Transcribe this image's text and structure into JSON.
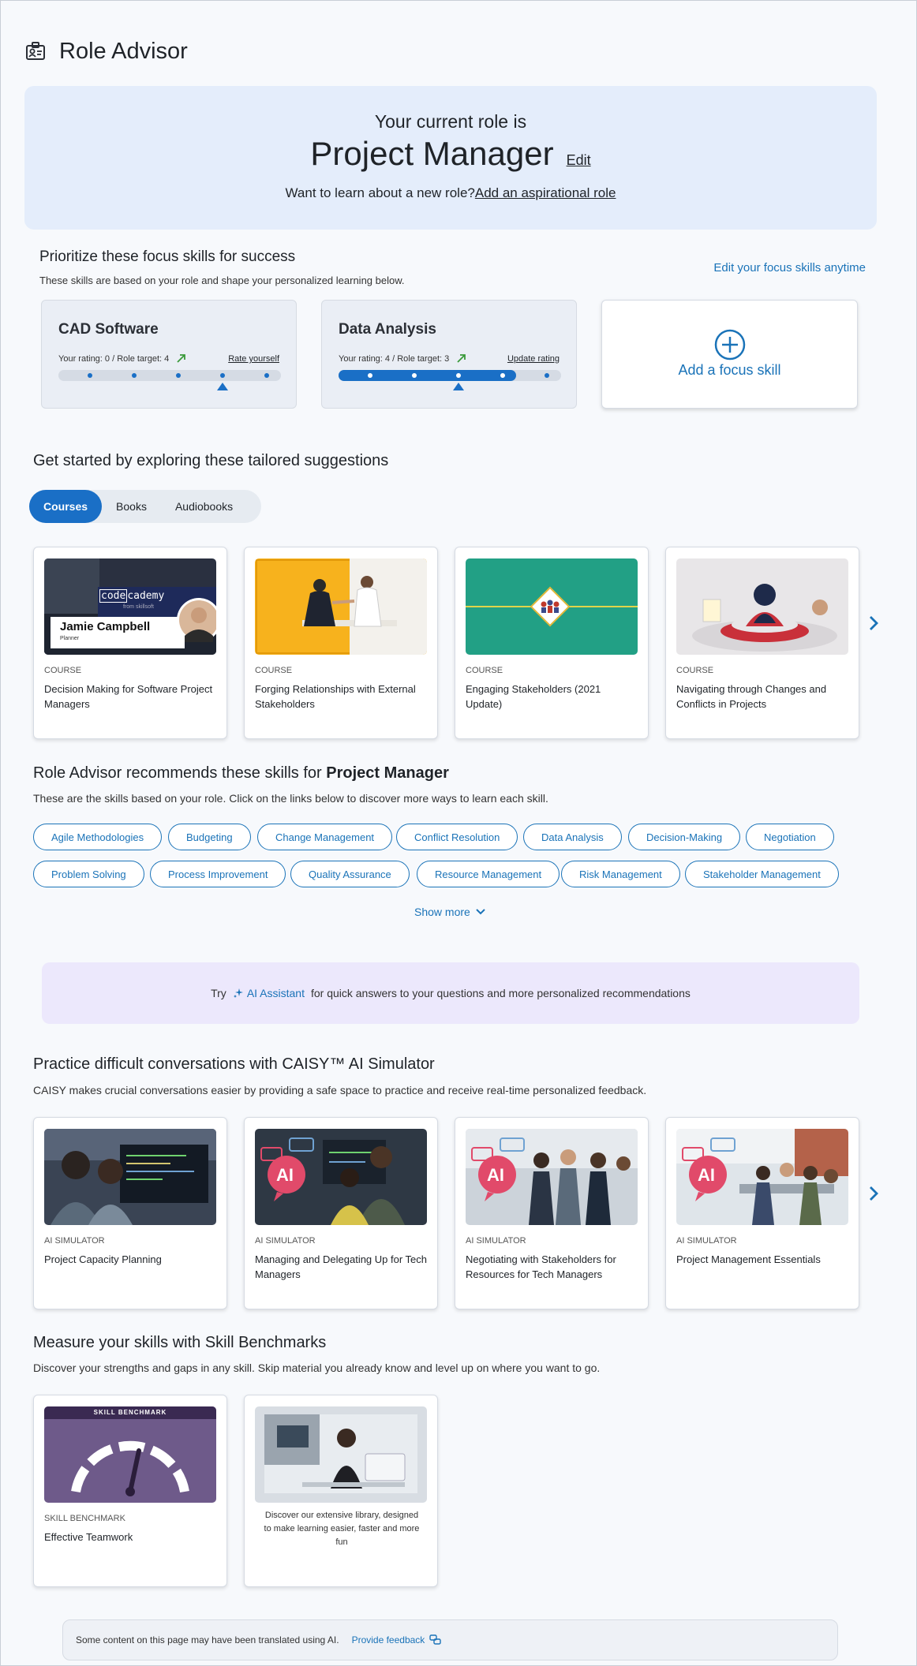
{
  "app": {
    "title": "Role Advisor",
    "icon": "id-badge-icon"
  },
  "hero": {
    "pre": "Your current role is",
    "role": "Project Manager",
    "edit_label": "Edit",
    "sub_text": "Want to learn about a new role?",
    "sub_link": "Add an aspirational role"
  },
  "focus": {
    "title": "Prioritize these focus skills for success",
    "description": "These skills are based on your role and shape your personalized learning below.",
    "edit_link": "Edit your focus skills anytime",
    "skills": [
      {
        "name": "CAD Software",
        "rating_text": "Your rating: 0 / Role target: 4",
        "rating": 0,
        "target": 4,
        "action": "Rate yourself"
      },
      {
        "name": "Data Analysis",
        "rating_text": "Your rating: 4 / Role target: 3",
        "rating": 4,
        "target": 3,
        "action": "Update rating"
      }
    ],
    "add_label": "Add a focus skill"
  },
  "suggestions": {
    "title": "Get started by exploring these tailored suggestions",
    "tabs": [
      "Courses",
      "Books",
      "Audiobooks"
    ],
    "active_tab": "Courses",
    "cards": [
      {
        "type": "COURSE",
        "title": "Decision Making for Software Project Managers",
        "thumb": {
          "brand_a": "code",
          "brand_b": "cademy",
          "brand_sub": "from skillsoft",
          "person": "Jamie Campbell",
          "person_role": "Planner"
        }
      },
      {
        "type": "COURSE",
        "title": "Forging Relationships with External Stakeholders"
      },
      {
        "type": "COURSE",
        "title": "Engaging Stakeholders (2021 Update)"
      },
      {
        "type": "COURSE",
        "title": "Navigating through Changes and Conflicts in Projects"
      }
    ]
  },
  "recommend": {
    "title_prefix": "Role Advisor recommends these skills for",
    "title_role": "Project Manager",
    "description": "These are the skills based on your role. Click on the links below to discover more ways to learn each skill.",
    "skills_row1": [
      "Agile Methodologies",
      "Budgeting",
      "Change Management",
      "Conflict Resolution",
      "Data Analysis",
      "Decision-Making",
      "Negotiation"
    ],
    "skills_row2": [
      "Problem Solving",
      "Process Improvement",
      "Quality Assurance",
      "Resource Management",
      "Risk Management",
      "Stakeholder Management"
    ],
    "show_more": "Show more"
  },
  "ai_banner": {
    "pre": "Try",
    "link": "AI Assistant",
    "post": "for quick answers to your questions and more personalized recommendations"
  },
  "caisy": {
    "title": "Practice difficult conversations with CAISY™ AI Simulator",
    "description": "CAISY makes crucial conversations easier by providing a safe space to practice and receive real-time personalized feedback.",
    "badge_text": "AI",
    "cards": [
      {
        "type": "AI SIMULATOR",
        "title": "Project Capacity Planning"
      },
      {
        "type": "AI SIMULATOR",
        "title": "Managing and Delegating Up for Tech Managers"
      },
      {
        "type": "AI SIMULATOR",
        "title": "Negotiating with Stakeholders for Resources for Tech Managers"
      },
      {
        "type": "AI SIMULATOR",
        "title": "Project Management Essentials"
      }
    ]
  },
  "benchmarks": {
    "title": "Measure your skills with Skill Benchmarks",
    "description": "Discover your strengths and gaps in any skill. Skip material you already know and level up on where you want to go.",
    "card": {
      "banner": "SKILL BENCHMARK",
      "type": "SKILL BENCHMARK",
      "title": "Effective Teamwork"
    },
    "library_text": "Discover our extensive library, designed to make learning easier, faster and more fun"
  },
  "footer": {
    "text": "Some content on this page may have been translated using AI.",
    "link": "Provide feedback"
  },
  "colors": {
    "accent": "#1a6fc6",
    "link": "#1a73b8",
    "hero_bg": "#e4edfb",
    "ai_bg": "#ece8fc",
    "trend": "#3a9a3a"
  }
}
